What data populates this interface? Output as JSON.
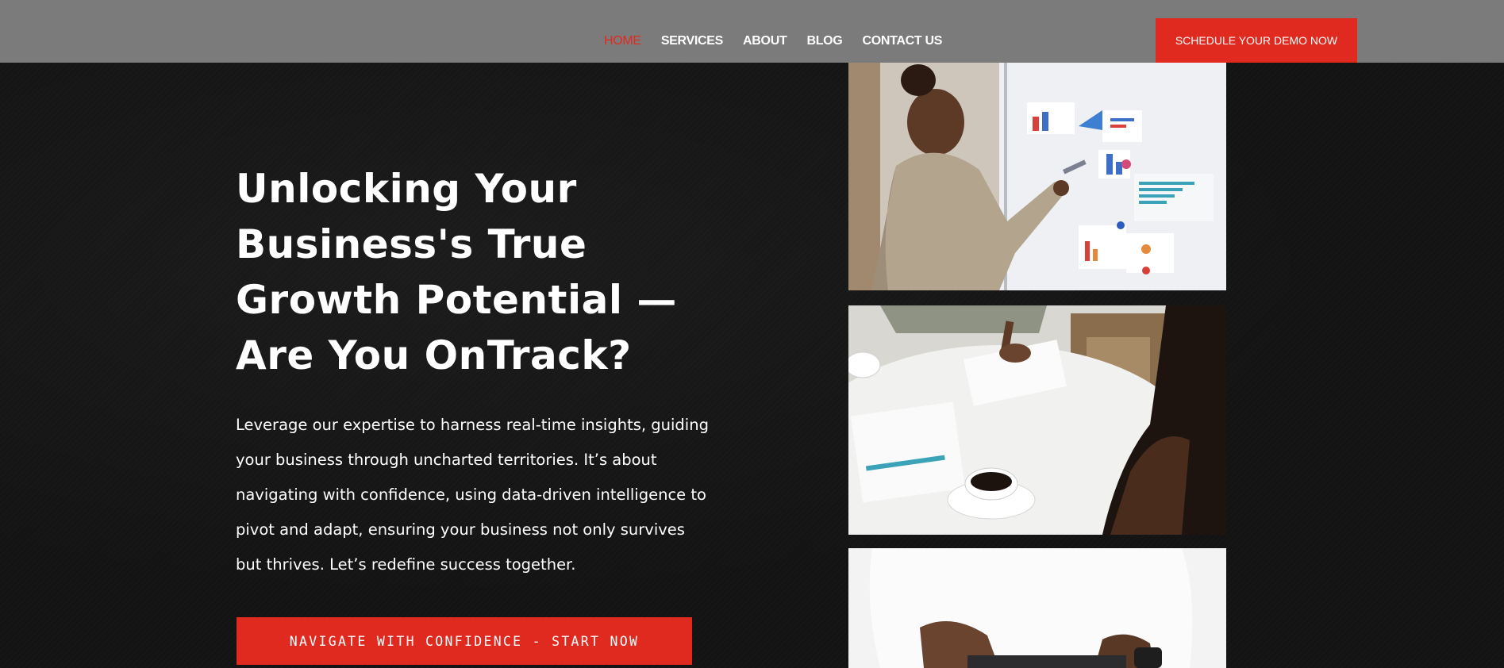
{
  "nav": {
    "items": [
      {
        "label": "HOME",
        "active": true
      },
      {
        "label": "SERVICES",
        "active": false
      },
      {
        "label": "ABOUT",
        "active": false
      },
      {
        "label": "BLOG",
        "active": false
      },
      {
        "label": "CONTACT US",
        "active": false
      }
    ],
    "demo_button": "SCHEDULE YOUR DEMO NOW"
  },
  "hero": {
    "title": "Unlocking Your Business's True Growth Potential — Are You OnTrack?",
    "body": "Leverage our expertise to harness real-time insights, guiding your business through uncharted territories. It’s about navigating with confidence, using data-driven intelligence to pivot and adapt, ensuring your business not only survives but thrives. Let’s redefine success together.",
    "cta": "NAVIGATE WITH CONFIDENCE - START NOW"
  },
  "colors": {
    "accent": "#e12a1f",
    "navbar": "#7b7b7b",
    "background": "#131313"
  },
  "images": [
    {
      "icon": "woman-presenting-charts-photo"
    },
    {
      "icon": "meeting-table-notes-coffee-photo"
    },
    {
      "icon": "person-typing-laptop-photo"
    }
  ]
}
